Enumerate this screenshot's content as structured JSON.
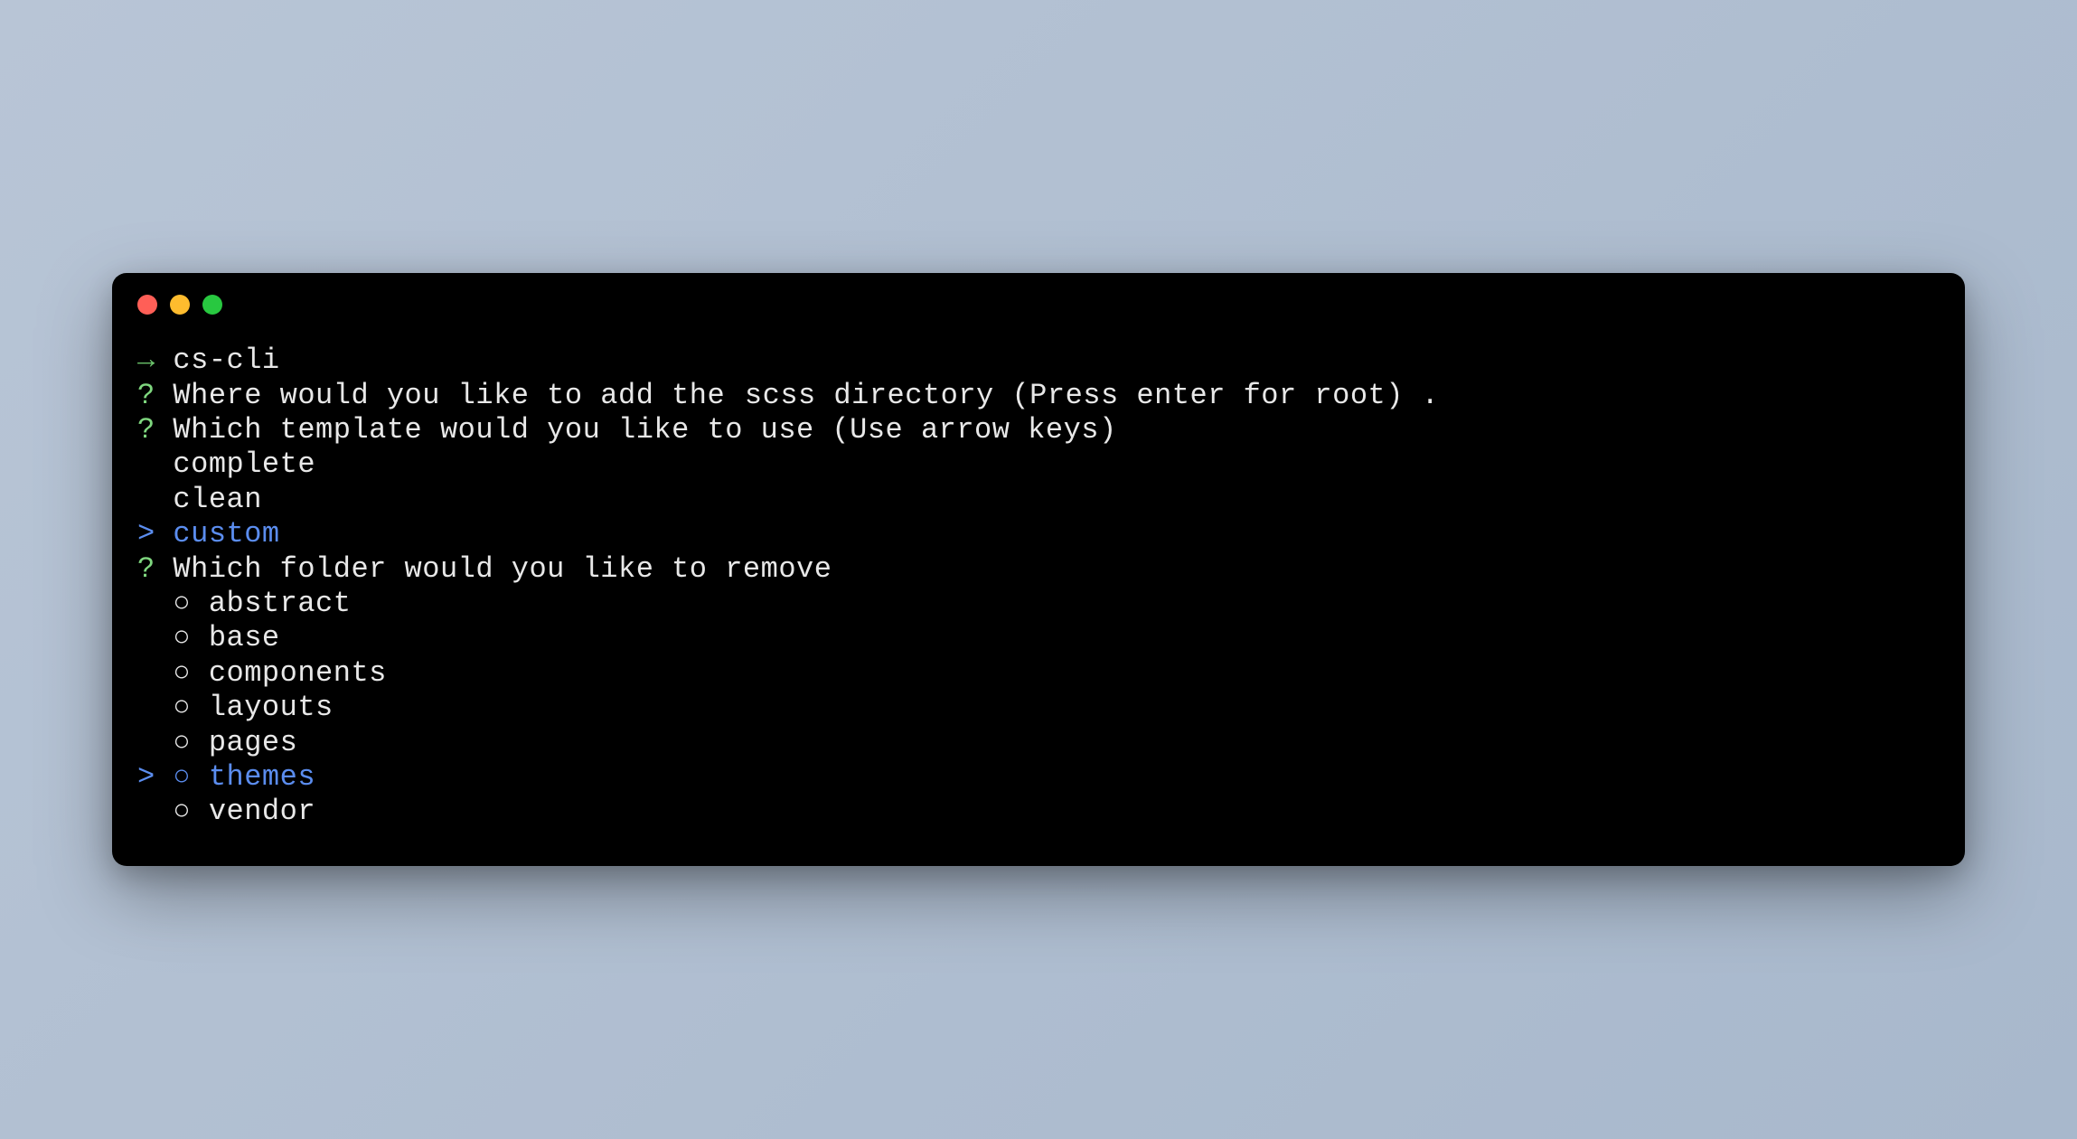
{
  "prompt": {
    "arrow": "→",
    "command": "cs-cli"
  },
  "questions": [
    {
      "marker": "?",
      "text": "Where would you like to add the ",
      "text_after": "scss directory",
      "hint": " (Press enter for root) ",
      "answer": "."
    },
    {
      "marker": "?",
      "text": "Which template would you like to use ",
      "hint": "(Use arrow keys)"
    }
  ],
  "template_options": [
    {
      "label": "complete",
      "selected": false
    },
    {
      "label": "clean",
      "selected": false
    },
    {
      "label": "custom",
      "selected": true
    }
  ],
  "folder_question": {
    "marker": "?",
    "text": "Which folder would you like to remove"
  },
  "folder_options": [
    {
      "label": "abstract",
      "selected": false
    },
    {
      "label": "base",
      "selected": false
    },
    {
      "label": "components",
      "selected": false
    },
    {
      "label": "layouts",
      "selected": false
    },
    {
      "label": "pages",
      "selected": false
    },
    {
      "label": "themes",
      "selected": true
    },
    {
      "label": "vendor",
      "selected": false
    }
  ],
  "symbols": {
    "selector": ">",
    "radio": "○"
  }
}
